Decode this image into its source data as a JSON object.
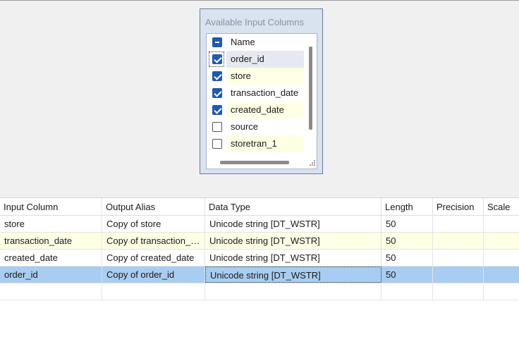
{
  "available_columns": {
    "title": "Available Input Columns",
    "header": {
      "label": "Name",
      "state": "indeterminate"
    },
    "items": [
      {
        "label": "order_id",
        "checked": true
      },
      {
        "label": "store",
        "checked": true
      },
      {
        "label": "transaction_date",
        "checked": true
      },
      {
        "label": "created_date",
        "checked": true
      },
      {
        "label": "source",
        "checked": false
      },
      {
        "label": "storetran_1",
        "checked": false
      }
    ]
  },
  "grid": {
    "columns": [
      "Input Column",
      "Output Alias",
      "Data Type",
      "Length",
      "Precision",
      "Scale"
    ],
    "rows": [
      [
        "store",
        "Copy of store",
        "Unicode string [DT_WSTR]",
        "50",
        "",
        ""
      ],
      [
        "transaction_date",
        "Copy of transaction_date",
        "Unicode string [DT_WSTR]",
        "50",
        "",
        ""
      ],
      [
        "created_date",
        "Copy of created_date",
        "Unicode string [DT_WSTR]",
        "50",
        "",
        ""
      ],
      [
        "order_id",
        "Copy of order_id",
        "Unicode string [DT_WSTR]",
        "50",
        "",
        ""
      ],
      [
        "",
        "",
        "",
        "",
        "",
        ""
      ]
    ]
  },
  "colors": {
    "selected_row": "#a8cdf0",
    "alt_row": "#ffffe6",
    "checkbox_blue": "#1e5ab4"
  }
}
